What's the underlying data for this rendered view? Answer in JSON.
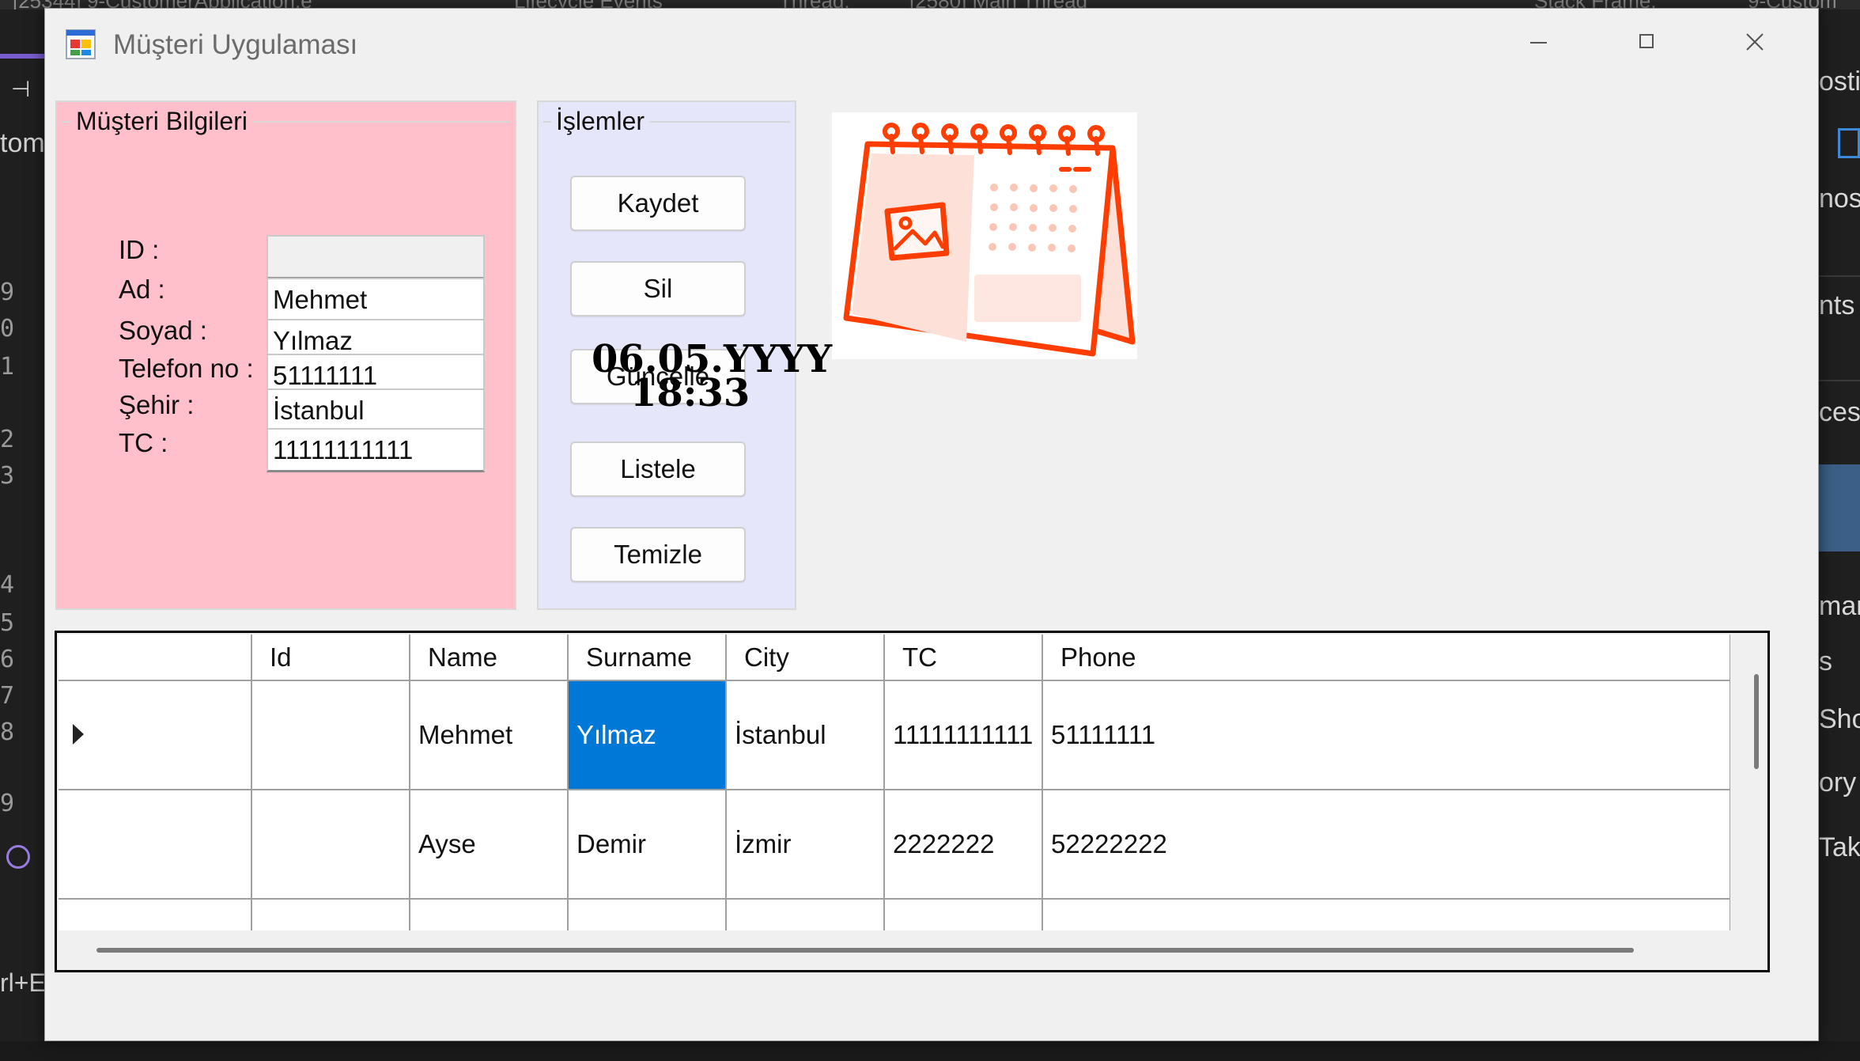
{
  "window": {
    "title": "Müşteri Uygulaması"
  },
  "customer_info": {
    "legend": "Müşteri Bilgileri",
    "fields": [
      {
        "label": "ID :",
        "value": ""
      },
      {
        "label": "Ad :",
        "value": "Mehmet"
      },
      {
        "label": "Soyad :",
        "value": "Yılmaz"
      },
      {
        "label": "Telefon no :",
        "value": "51111111"
      },
      {
        "label": "Şehir :",
        "value": "İstanbul"
      },
      {
        "label": "TC :",
        "value": "11111111111"
      }
    ]
  },
  "operations": {
    "legend": "İşlemler",
    "buttons": [
      "Kaydet",
      "Sil",
      "Güncelle",
      "Listele",
      "Temizle"
    ]
  },
  "clock": {
    "date": "06.05.YYYY",
    "time": "18:33"
  },
  "grid": {
    "columns": [
      "Id",
      "Name",
      "Surname",
      "City",
      "TC",
      "Phone"
    ],
    "rows": [
      [
        "",
        "Mehmet",
        "Yılmaz",
        "İstanbul",
        "11111111111",
        "51111111"
      ],
      [
        "",
        "Ayse",
        "Demir",
        "İzmir",
        "2222222",
        "52222222"
      ]
    ],
    "selected_cell": "Yılmaz"
  },
  "colors": {
    "info_panel": "#ffc0cb",
    "ops_panel": "#e6e6fa",
    "selection": "#0078d7",
    "calendar_icon": "#ff3d00"
  },
  "background_ide": {
    "top_fragments": [
      "[25344] 9-CustomerApplication.e",
      "Lifecycle Events",
      "Thread:",
      "[2580] Main Thread",
      "Stack Frame:",
      "9-Custom"
    ],
    "left_fragments": [
      "tom",
      "rl+E"
    ],
    "line_numbers": [
      "9",
      "0",
      "1",
      "2",
      "3",
      "4",
      "5",
      "6",
      "7",
      "8",
      "9"
    ],
    "right_fragments": [
      "ostic",
      "nost",
      "nts",
      "cess",
      "mary",
      "s",
      "Sho",
      "ory",
      "Take"
    ]
  }
}
